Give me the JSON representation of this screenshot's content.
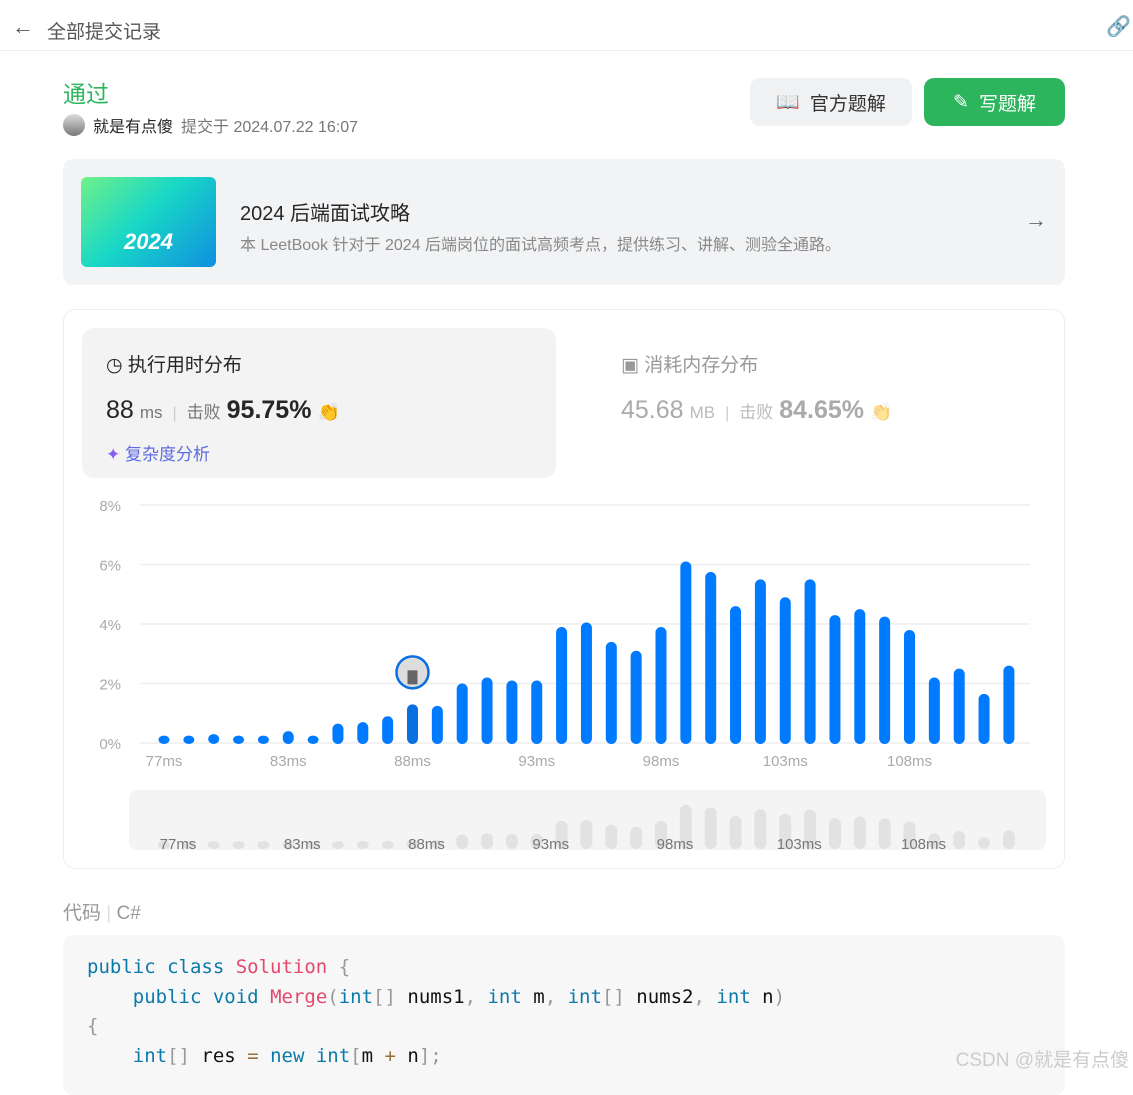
{
  "header": {
    "title": "全部提交记录",
    "back_icon": "arrow-left-icon",
    "share_icon": "link-icon"
  },
  "submission": {
    "status": "通过",
    "user": "就是有点傻",
    "submitted_at": "提交于 2024.07.22 16:07",
    "status_color": "#2db55d"
  },
  "buttons": {
    "official": "官方题解",
    "write": "写题解"
  },
  "leetbook": {
    "cover_text": "2024",
    "title": "2024 后端面试攻略",
    "desc": "本 LeetBook 针对于 2024 后端岗位的面试高频考点，提供练习、讲解、测验全通路。"
  },
  "runtime": {
    "title": "执行用时分布",
    "value": "88",
    "unit": "ms",
    "beats_label": "击败",
    "beats": "95.75%",
    "complexity": "复杂度分析"
  },
  "memory": {
    "title": "消耗内存分布",
    "value": "45.68",
    "unit": "MB",
    "beats_label": "击败",
    "beats": "84.65%"
  },
  "chart_data": {
    "type": "bar",
    "yticks": [
      "0%",
      "2%",
      "4%",
      "6%",
      "8%"
    ],
    "ylim": [
      0,
      8
    ],
    "grid": true,
    "bar_color": "#007aff",
    "highlight_index": 10,
    "xtick_labels": {
      "0": "77ms",
      "5": "83ms",
      "10": "88ms",
      "15": "93ms",
      "20": "98ms",
      "25": "103ms",
      "30": "108ms"
    },
    "values": [
      0.25,
      0.25,
      0.3,
      0.25,
      0.25,
      0.4,
      0.25,
      0.65,
      0.7,
      0.9,
      1.3,
      1.25,
      2.0,
      2.2,
      2.1,
      2.1,
      3.9,
      4.05,
      3.4,
      3.1,
      3.9,
      6.1,
      5.75,
      4.6,
      5.5,
      4.9,
      5.5,
      4.3,
      4.5,
      4.25,
      3.8,
      2.2,
      2.5,
      1.65,
      2.6
    ]
  },
  "code": {
    "label": "代码",
    "lang": "C#"
  },
  "watermark": "CSDN @就是有点傻"
}
